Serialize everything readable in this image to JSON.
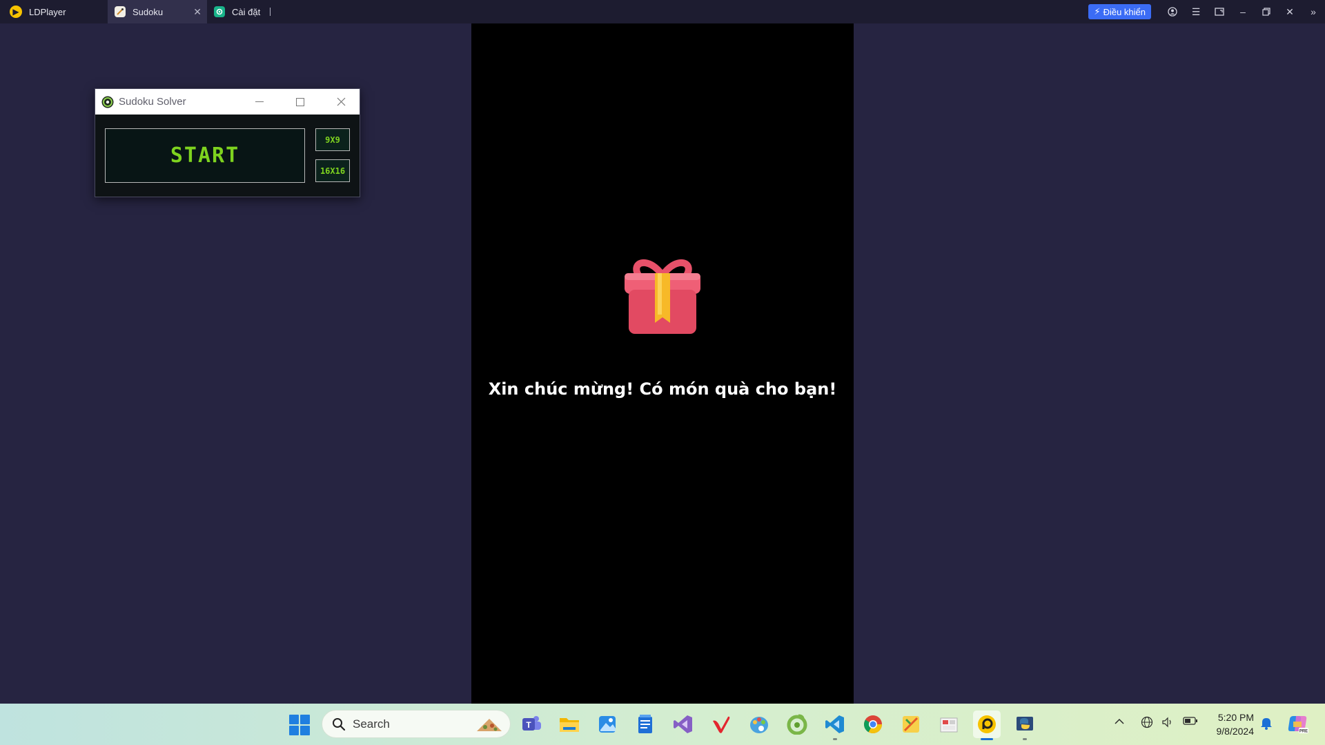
{
  "ldplayer": {
    "brand_label": "LDPlayer",
    "tabs": [
      {
        "label": "Sudoku",
        "active": true
      },
      {
        "label": "Cài đặt",
        "active": false
      }
    ],
    "control_label": "Điều khiển"
  },
  "game": {
    "message": "Xin chúc mừng! Có món quà cho bạn!"
  },
  "solver": {
    "title": "Sudoku Solver",
    "start_label": "START",
    "size_9_label": "9X9",
    "size_16_label": "16X16"
  },
  "taskbar": {
    "search_placeholder": "Search",
    "time": "5:20 PM",
    "date": "9/8/2024",
    "apps": [
      "teams-icon",
      "file-explorer-icon",
      "photos-icon",
      "notepad-icon",
      "visual-studio-icon",
      "vivaldi-icon",
      "paint-icon",
      "coccoc-icon",
      "vscode-icon",
      "chrome-icon",
      "gamepad-icon",
      "snipping-icon",
      "ldplayer-icon",
      "python-icon"
    ]
  },
  "colors": {
    "desktop_bg": "#262441",
    "accent_green": "#7ed31f",
    "control_blue": "#3b6cf5"
  }
}
